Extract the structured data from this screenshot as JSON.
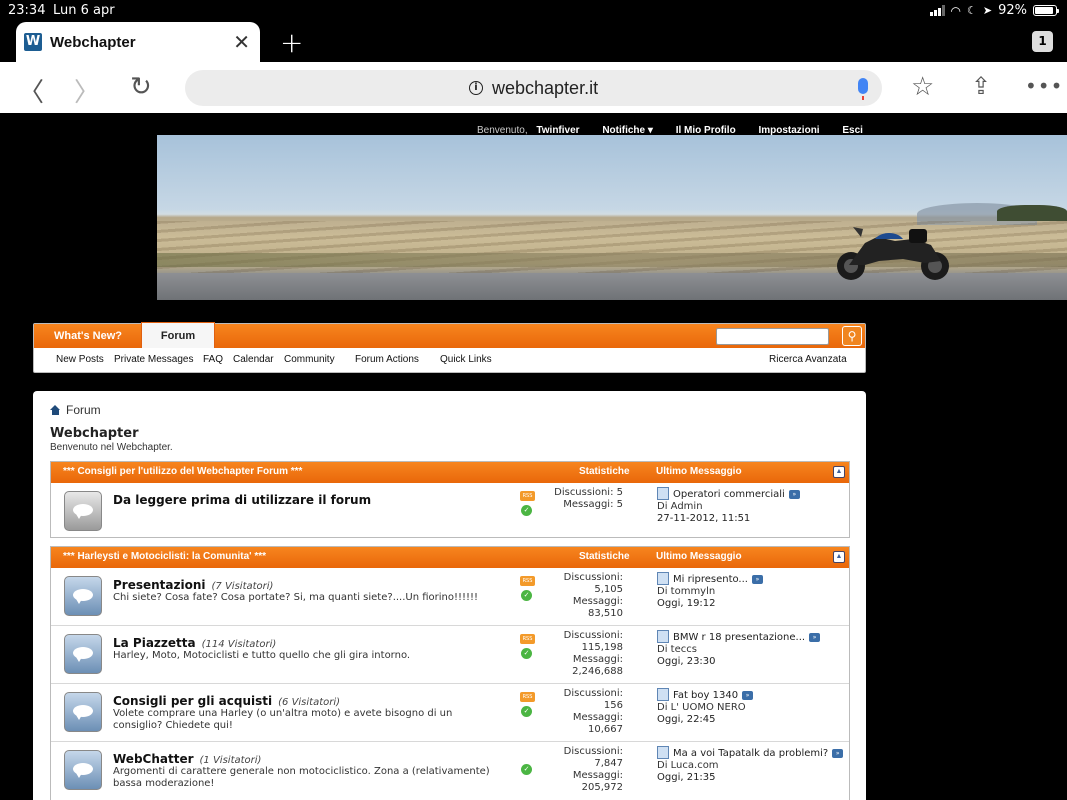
{
  "status_bar": {
    "time": "23:34",
    "date": "Lun 6 apr",
    "battery": "92%",
    "battery_level": 0.92
  },
  "browser": {
    "tab_title": "Webchapter",
    "tab_count": "1",
    "url": "webchapter.it",
    "icons": {
      "back": "chevron-left-icon",
      "forward": "chevron-right-icon",
      "reload": "reload-icon",
      "bookmark": "star-icon",
      "share": "share-icon",
      "menu": "more-icon"
    }
  },
  "userbar": {
    "welcome": "Benvenuto,",
    "username": "Twinfiver",
    "notifications": "Notifiche ▾",
    "profile": "Il Mio Profilo",
    "settings": "Impostazioni",
    "logout": "Esci"
  },
  "navbar": {
    "tabs": [
      "What's New?",
      "Forum"
    ],
    "links": [
      "New Posts",
      "Private Messages",
      "FAQ",
      "Calendar",
      "Community",
      "Forum Actions",
      "Quick Links"
    ],
    "advanced_search": "Ricerca Avanzata"
  },
  "forum": {
    "breadcrumb": "Forum",
    "title": "Webchapter",
    "subtitle": "Benvenuto nel Webchapter.",
    "sections": [
      {
        "name": "*** Consigli per l'utilizzo del Webchapter Forum ***",
        "stats_header": "Statistiche",
        "last_header": "Ultimo Messaggio",
        "forums": [
          {
            "name": "Da leggere prima di utilizzare il forum",
            "viewers": "",
            "description": "",
            "stats_line1": "Discussioni: 5",
            "stats_line2": "Messaggi: 5",
            "stats_line3": "",
            "stats_line4": "",
            "last_post": "Operatori commerciali",
            "last_by": "Di Admin",
            "last_time": "27-11-2012, 11:51"
          }
        ]
      },
      {
        "name": "*** Harleysti e Motociclisti: la Comunita' ***",
        "stats_header": "Statistiche",
        "last_header": "Ultimo Messaggio",
        "forums": [
          {
            "name": "Presentazioni",
            "viewers": "(7 Visitatori)",
            "description": "Chi siete? Cosa fate? Cosa portate? Si, ma quanti siete?....Un fiorino!!!!!!",
            "stats_line1": "Discussioni:",
            "stats_line2": "5,105",
            "stats_line3": "Messaggi:",
            "stats_line4": "83,510",
            "last_post": "Mi ripresento...",
            "last_by": "Di tommyln",
            "last_time": "Oggi, 19:12"
          },
          {
            "name": "La Piazzetta",
            "viewers": "(114 Visitatori)",
            "description": "Harley, Moto, Motociclisti e tutto quello che gli gira intorno.",
            "stats_line1": "Discussioni:",
            "stats_line2": "115,198",
            "stats_line3": "Messaggi:",
            "stats_line4": "2,246,688",
            "last_post": "BMW r 18 presentazione...",
            "last_by": "Di teccs",
            "last_time": "Oggi, 23:30"
          },
          {
            "name": "Consigli per gli acquisti",
            "viewers": "(6 Visitatori)",
            "description": "Volete comprare una Harley (o un'altra moto) e avete bisogno di un consiglio? Chiedete qui!",
            "stats_line1": "Discussioni:",
            "stats_line2": "156",
            "stats_line3": "Messaggi:",
            "stats_line4": "10,667",
            "last_post": "Fat boy 1340",
            "last_by": "Di L' UOMO NERO",
            "last_time": "Oggi, 22:45"
          },
          {
            "name": "WebChatter",
            "viewers": "(1 Visitatori)",
            "description": "Argomenti di carattere generale non motociclistico. Zona a (relativamente) bassa moderazione!",
            "stats_line1": "Discussioni:",
            "stats_line2": "7,847",
            "stats_line3": "Messaggi:",
            "stats_line4": "205,972",
            "last_post": "Ma a voi Tapatalk da problemi?",
            "last_by": "Di Luca.com",
            "last_time": "Oggi, 21:35"
          }
        ]
      }
    ]
  }
}
